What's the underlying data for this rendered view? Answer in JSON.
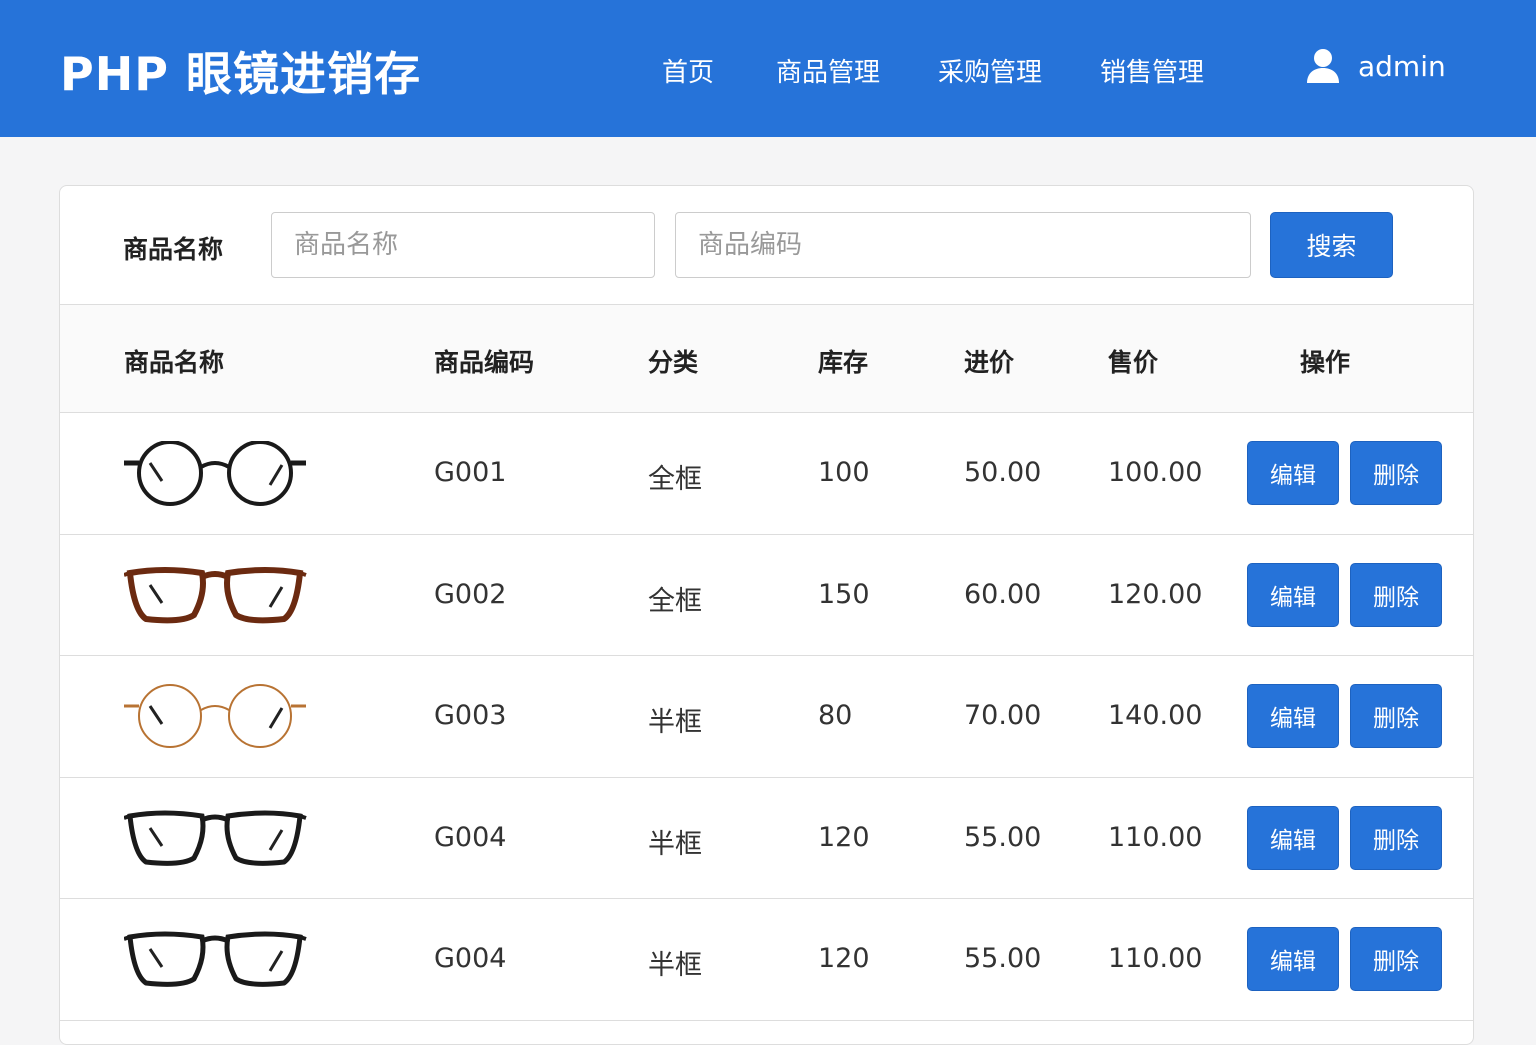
{
  "header": {
    "title": "PHP 眼镜进销存",
    "nav": [
      "首页",
      "商品管理",
      "采购管理",
      "销售管理"
    ],
    "user": "admin"
  },
  "search": {
    "label": "商品名称",
    "name_placeholder": "商品名称",
    "code_placeholder": "商品编码",
    "button": "搜索"
  },
  "table": {
    "headers": [
      "商品名称",
      "商品编码",
      "分类",
      "库存",
      "进价",
      "售价",
      "操作"
    ],
    "edit_label": "编辑",
    "delete_label": "删除",
    "rows": [
      {
        "code": "G001",
        "category": "全框",
        "stock": "100",
        "cost": "50.00",
        "price": "100.00",
        "frame_color": "#1a1a1a",
        "shape": "round"
      },
      {
        "code": "G002",
        "category": "全框",
        "stock": "150",
        "cost": "60.00",
        "price": "120.00",
        "frame_color": "#6b2a10",
        "shape": "square"
      },
      {
        "code": "G003",
        "category": "半框",
        "stock": "80",
        "cost": "70.00",
        "price": "140.00",
        "frame_color": "#b87333",
        "shape": "round-thin"
      },
      {
        "code": "G004",
        "category": "半框",
        "stock": "120",
        "cost": "55.00",
        "price": "110.00",
        "frame_color": "#1a1a1a",
        "shape": "square"
      },
      {
        "code": "G004",
        "category": "半框",
        "stock": "120",
        "cost": "55.00",
        "price": "110.00",
        "frame_color": "#1a1a1a",
        "shape": "square"
      }
    ]
  }
}
